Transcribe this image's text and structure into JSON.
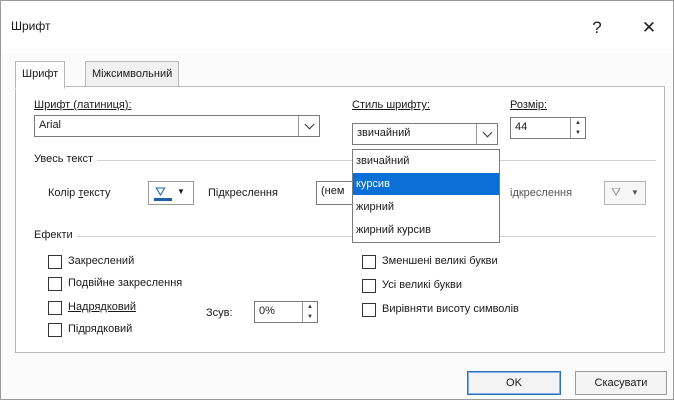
{
  "window": {
    "title": "Шрифт",
    "help_label": "?",
    "close_label": "✕"
  },
  "tabs": [
    {
      "label": "Шрифт",
      "active": true
    },
    {
      "label": "Міжсимвольний інтервал",
      "active": false
    }
  ],
  "font": {
    "label": "Шрифт (латиниця):",
    "value": "Arial"
  },
  "style": {
    "label": "Стиль шрифту:",
    "value": "звичайний",
    "options": [
      "звичайний",
      "курсив",
      "жирний",
      "жирний курсив"
    ],
    "highlighted_index": 1
  },
  "size": {
    "label": "Розмір:",
    "value": "44"
  },
  "all_text": {
    "section_title": "Увесь текст",
    "color_label": "Колір тексту",
    "underline_label": "Підкреслення",
    "underline_value": "(нем",
    "underline_color_label": "ідкреслення"
  },
  "effects": {
    "section_title": "Ефекти",
    "left": [
      "Закреслений",
      "Подвійне закреслення",
      "Надрядковий",
      "Підрядковий"
    ],
    "right": [
      "Зменшені великі букви",
      "Усі великі букви",
      "Вирівняти висоту символів"
    ],
    "offset_label": "Зсув:",
    "offset_value": "0%"
  },
  "buttons": {
    "ok": "OK",
    "cancel": "Скасувати"
  },
  "colors": {
    "selection": "#0a6fd6",
    "accent_top": "#1a9b8a"
  }
}
